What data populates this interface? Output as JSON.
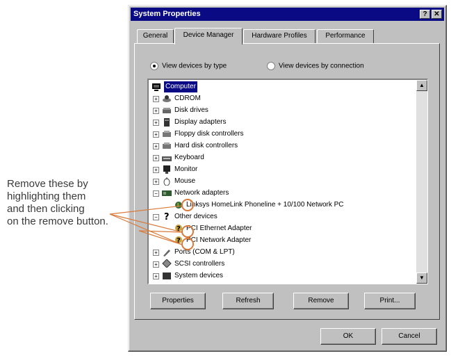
{
  "annotation": {
    "lines": [
      "Remove these by",
      "highlighting them",
      "and then clicking",
      "on the remove button."
    ]
  },
  "window": {
    "title": "System Properties",
    "help_button": "?",
    "close_button": "✕"
  },
  "tabs": [
    "General",
    "Device Manager",
    "Hardware Profiles",
    "Performance"
  ],
  "view_options": [
    {
      "label": "View devices by type",
      "selected": true
    },
    {
      "label": "View devices by connection",
      "selected": false
    }
  ],
  "tree": {
    "root": "Computer",
    "items": [
      {
        "label": "CDROM",
        "icon": "cdrom-icon"
      },
      {
        "label": "Disk drives",
        "icon": "disk-icon"
      },
      {
        "label": "Display adapters",
        "icon": "display-icon"
      },
      {
        "label": "Floppy disk controllers",
        "icon": "floppy-icon"
      },
      {
        "label": "Hard disk controllers",
        "icon": "harddisk-icon"
      },
      {
        "label": "Keyboard",
        "icon": "keyboard-icon"
      },
      {
        "label": "Monitor",
        "icon": "monitor-icon"
      },
      {
        "label": "Mouse",
        "icon": "mouse-icon"
      },
      {
        "label": "Network adapters",
        "icon": "network-icon"
      },
      {
        "label": "Linksys HomeLink Phoneline + 10/100 Network PC",
        "icon": "network-warning-icon"
      },
      {
        "label": "Other devices",
        "icon": "question-icon"
      },
      {
        "label": "PCI Ethernet Adapter",
        "icon": "question-icon"
      },
      {
        "label": "PCI Network Adapter",
        "icon": "question-icon"
      },
      {
        "label": "Ports (COM & LPT)",
        "icon": "port-icon"
      },
      {
        "label": "SCSI controllers",
        "icon": "scsi-icon"
      },
      {
        "label": "System devices",
        "icon": "system-icon"
      }
    ]
  },
  "panel_buttons": [
    "Properties",
    "Refresh",
    "Remove",
    "Print..."
  ],
  "dialog_buttons": [
    "OK",
    "Cancel"
  ],
  "colors": {
    "titlebar": "#0a0a84",
    "highlight_circle": "#d97a3a"
  }
}
